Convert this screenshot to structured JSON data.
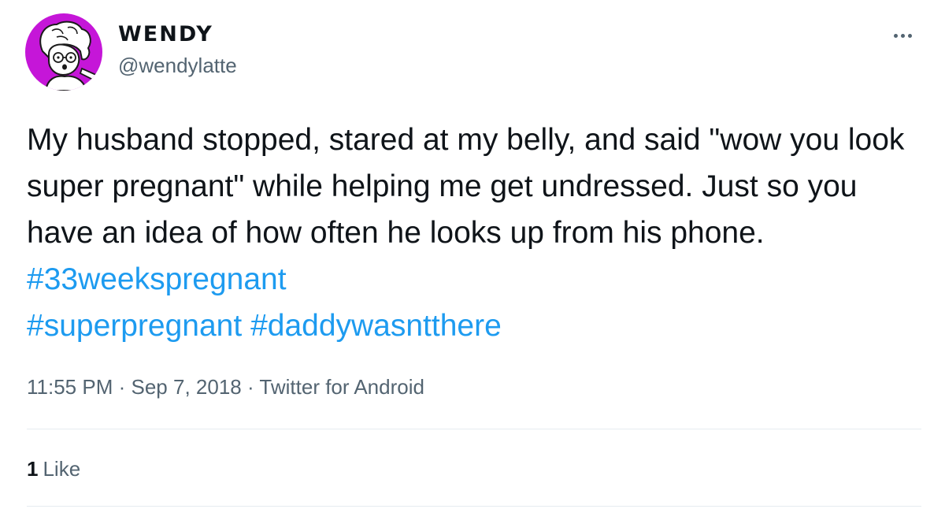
{
  "author": {
    "display_name": "WENDY",
    "handle": "@wendylatte",
    "avatar_icon": "cartoon-avatar-icon",
    "avatar_bg": "#c516d8"
  },
  "tweet": {
    "text_plain": "My husband stopped, stared at my belly, and said \"wow you look super pregnant\" while helping me get undressed. Just so you have an idea of how often he looks up from his phone. ",
    "hashtags": [
      "#33weekspregnant",
      "#superpregnant",
      "#daddywasntthere"
    ],
    "hashtag_color": "#1d9bf0"
  },
  "meta": {
    "time": "11:55 PM",
    "separator": "·",
    "date": "Sep 7, 2018",
    "source": "Twitter for Android"
  },
  "stats": {
    "like_count": "1",
    "like_label": "Like"
  },
  "menu": {
    "more_icon": "more-horizontal-icon"
  }
}
